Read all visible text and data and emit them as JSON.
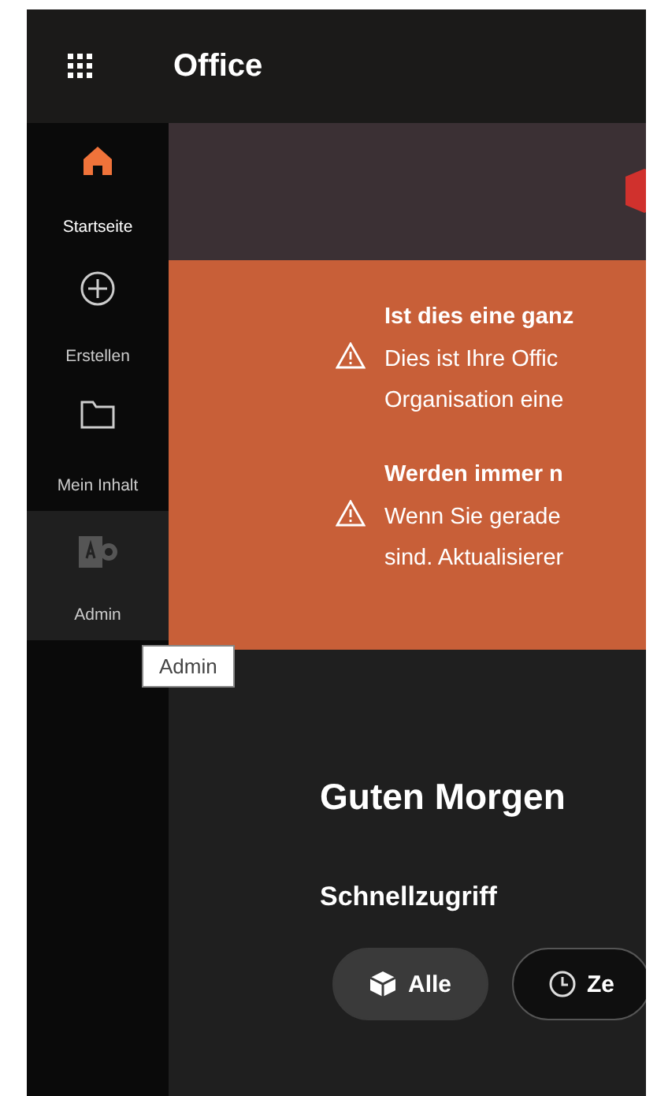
{
  "top_bar": {
    "title": "Office"
  },
  "sidebar": {
    "items": [
      {
        "label": "Startseite",
        "selected": true,
        "hovered": false
      },
      {
        "label": "Erstellen",
        "selected": false,
        "hovered": false
      },
      {
        "label": "Mein Inhalt",
        "selected": false,
        "hovered": false
      },
      {
        "label": "Admin",
        "selected": false,
        "hovered": true
      }
    ]
  },
  "tooltip": {
    "text": "Admin"
  },
  "alerts": [
    {
      "title": "Ist dies eine ganz",
      "lines": [
        "Dies ist Ihre Offic",
        "Organisation eine"
      ]
    },
    {
      "title": "Werden immer n",
      "lines": [
        "Wenn Sie gerade",
        "sind. Aktualisierer"
      ]
    }
  ],
  "greeting": "Guten Morgen",
  "quick_access": {
    "heading": "Schnellzugriff",
    "filters": [
      {
        "label": "Alle",
        "selected": true
      },
      {
        "label": "Ze",
        "selected": false
      }
    ]
  }
}
